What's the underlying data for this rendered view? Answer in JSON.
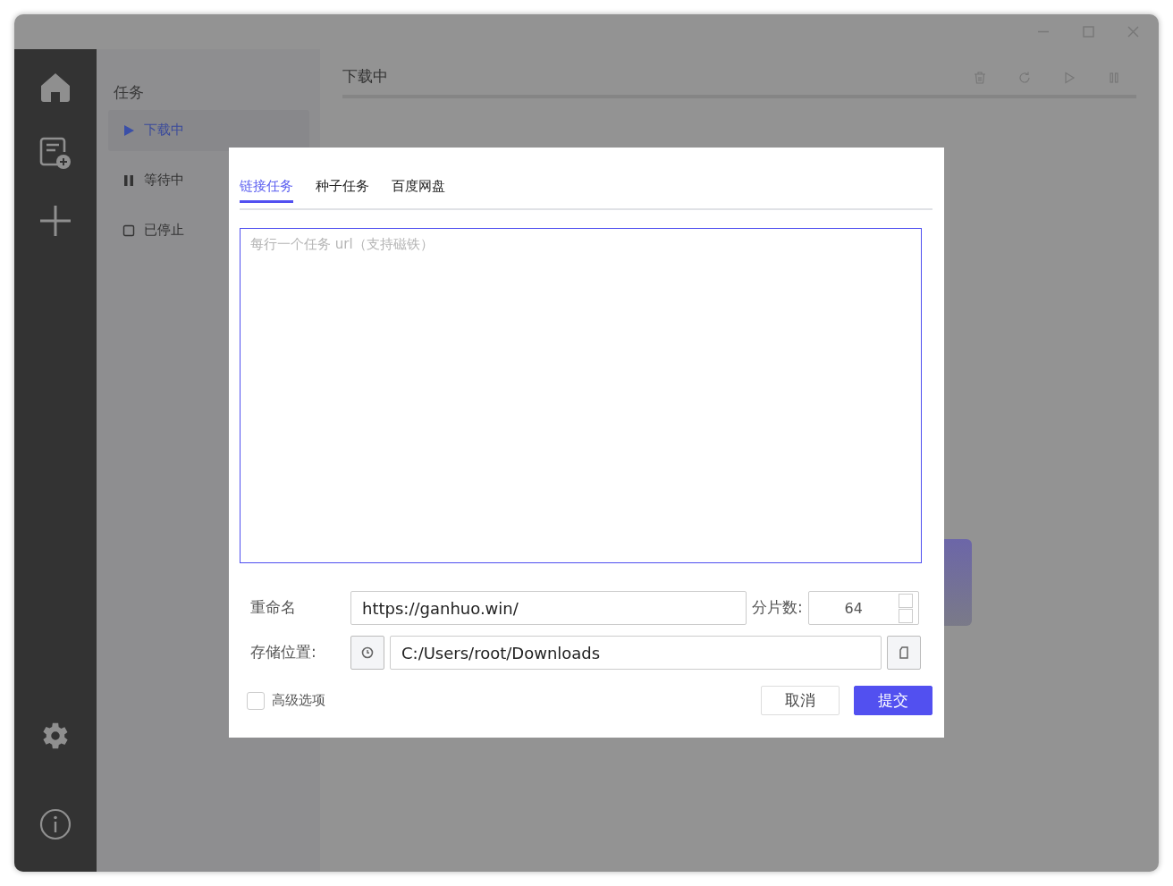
{
  "sidebar": {
    "items": [
      {
        "kind": "home"
      },
      {
        "kind": "new-task"
      },
      {
        "kind": "add"
      }
    ],
    "bottom_items": [
      {
        "kind": "settings"
      },
      {
        "kind": "info"
      }
    ]
  },
  "task_panel": {
    "title": "任务",
    "items": [
      {
        "label": "下载中",
        "kind": "downloading",
        "selected": true
      },
      {
        "label": "等待中",
        "kind": "waiting",
        "selected": false
      },
      {
        "label": "已停止",
        "kind": "stopped",
        "selected": false
      }
    ]
  },
  "main": {
    "title": "下载中",
    "toolbar": [
      {
        "kind": "delete"
      },
      {
        "kind": "refresh"
      },
      {
        "kind": "play"
      },
      {
        "kind": "pause"
      }
    ]
  },
  "dialog": {
    "tabs": [
      {
        "label": "链接任务",
        "selected": true
      },
      {
        "label": "种子任务",
        "selected": false
      },
      {
        "label": "百度网盘",
        "selected": false
      }
    ],
    "url_input": {
      "placeholder": "每行一个任务 url（支持磁铁）"
    },
    "rename": {
      "label": "重命名",
      "value": "https://ganhuo.win/"
    },
    "shards": {
      "label": "分片数:",
      "value": "64"
    },
    "storage": {
      "label": "存储位置:",
      "value": "C:/Users/root/Downloads"
    },
    "advanced": {
      "label": "高级选项",
      "checked": false
    },
    "buttons": [
      {
        "label": "取消",
        "kind": "secondary"
      },
      {
        "label": "提交",
        "kind": "primary"
      }
    ]
  }
}
